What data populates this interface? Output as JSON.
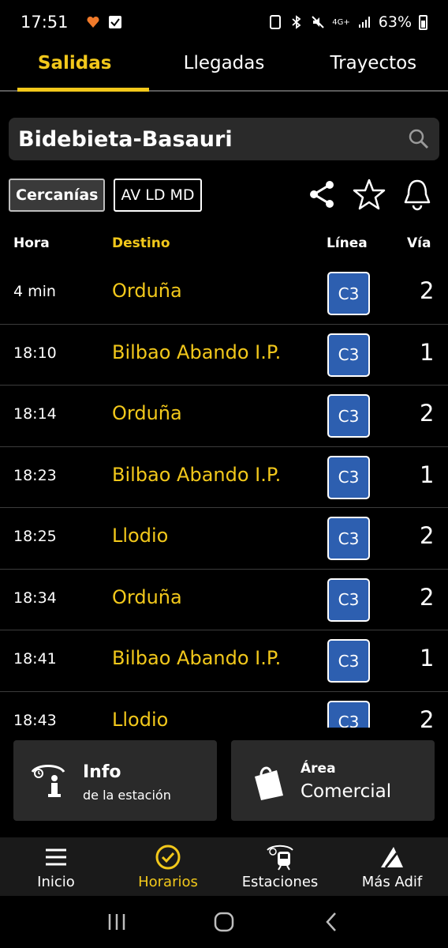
{
  "status_bar": {
    "time": "17:51",
    "battery": "63%",
    "network": "4G+"
  },
  "tabs": [
    {
      "label": "Salidas",
      "active": true
    },
    {
      "label": "Llegadas",
      "active": false
    },
    {
      "label": "Trayectos",
      "active": false
    }
  ],
  "search": {
    "station": "Bidebieta-Basauri",
    "icon": "search-icon"
  },
  "filters": [
    {
      "label": "Cercanías",
      "active": true
    },
    {
      "label": "AV LD MD",
      "active": false
    }
  ],
  "actions": [
    "share-icon",
    "star-icon",
    "bell-icon"
  ],
  "table": {
    "headers": {
      "hora": "Hora",
      "destino": "Destino",
      "linea": "Línea",
      "via": "Vía"
    },
    "rows": [
      {
        "hora": "4 min",
        "destino": "Orduña",
        "linea": "C3",
        "via": "2"
      },
      {
        "hora": "18:10",
        "destino": "Bilbao Abando I.P.",
        "linea": "C3",
        "via": "1"
      },
      {
        "hora": "18:14",
        "destino": "Orduña",
        "linea": "C3",
        "via": "2"
      },
      {
        "hora": "18:23",
        "destino": "Bilbao Abando I.P.",
        "linea": "C3",
        "via": "1"
      },
      {
        "hora": "18:25",
        "destino": "Llodio",
        "linea": "C3",
        "via": "2"
      },
      {
        "hora": "18:34",
        "destino": "Orduña",
        "linea": "C3",
        "via": "2"
      },
      {
        "hora": "18:41",
        "destino": "Bilbao Abando I.P.",
        "linea": "C3",
        "via": "1"
      },
      {
        "hora": "18:43",
        "destino": "Llodio",
        "linea": "C3",
        "via": "2"
      }
    ]
  },
  "cards": [
    {
      "title": "Info",
      "subtitle": "de la estación",
      "icon": "info-desk-icon"
    },
    {
      "title": "Área",
      "subtitle": "Comercial",
      "icon": "shopping-bag-icon"
    }
  ],
  "bottom_nav": [
    {
      "label": "Inicio",
      "icon": "menu-icon",
      "active": false
    },
    {
      "label": "Horarios",
      "icon": "clock-icon",
      "active": true
    },
    {
      "label": "Estaciones",
      "icon": "station-icon",
      "active": false
    },
    {
      "label": "Más Adif",
      "icon": "adif-logo-icon",
      "active": false
    }
  ],
  "colors": {
    "accent": "#f2c81b",
    "line_badge": "#2d5fb0",
    "background": "#000000",
    "surface": "#2a2a2a"
  }
}
